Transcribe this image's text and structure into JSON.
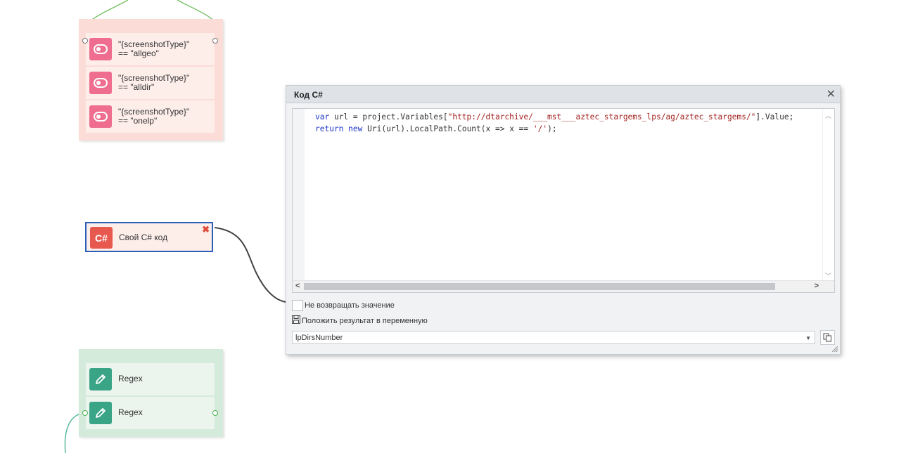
{
  "conditions_group": {
    "items": [
      {
        "line1": "\"{screenshotType}\"",
        "line2": "== \"allgeo\""
      },
      {
        "line1": "\"{screenshotType}\"",
        "line2": "== \"alldir\""
      },
      {
        "line1": "\"{screenshotType}\"",
        "line2": "== \"onelp\""
      }
    ]
  },
  "csharp_node": {
    "icon_text": "C#",
    "label": "Свой C# код"
  },
  "regex_group": {
    "items": [
      {
        "label": "Regex"
      },
      {
        "label": "Regex"
      }
    ]
  },
  "dialog": {
    "title": "Код C#",
    "code": {
      "line1": {
        "kw": "var",
        "mid": " url = project.Variables[",
        "str": "\"http://dtarchive/___mst___aztec_stargems_lps/ag/aztec_stargems/\"",
        "end": "].Value;"
      },
      "line2": {
        "kw1": "return",
        "sp": " ",
        "kw2": "new",
        "mid": " Uri(url).LocalPath.Count(x => x == ",
        "str": "'/'",
        "end": ");"
      }
    },
    "no_return_label": "Не возвращать значение",
    "save_result_label": "Положить результат в переменную",
    "variable_value": "lpDirsNumber"
  },
  "colors": {
    "condition_group_bg": "#fcdcd6",
    "regex_group_bg": "#d4ebdc",
    "toggle_icon_bg": "#ef6d8e",
    "pencil_icon_bg": "#3aa487",
    "csharp_icon_bg": "#e7594f",
    "selected_border": "#2b5fb8",
    "keyword": "#1c35c9",
    "string": "#a0201c"
  }
}
